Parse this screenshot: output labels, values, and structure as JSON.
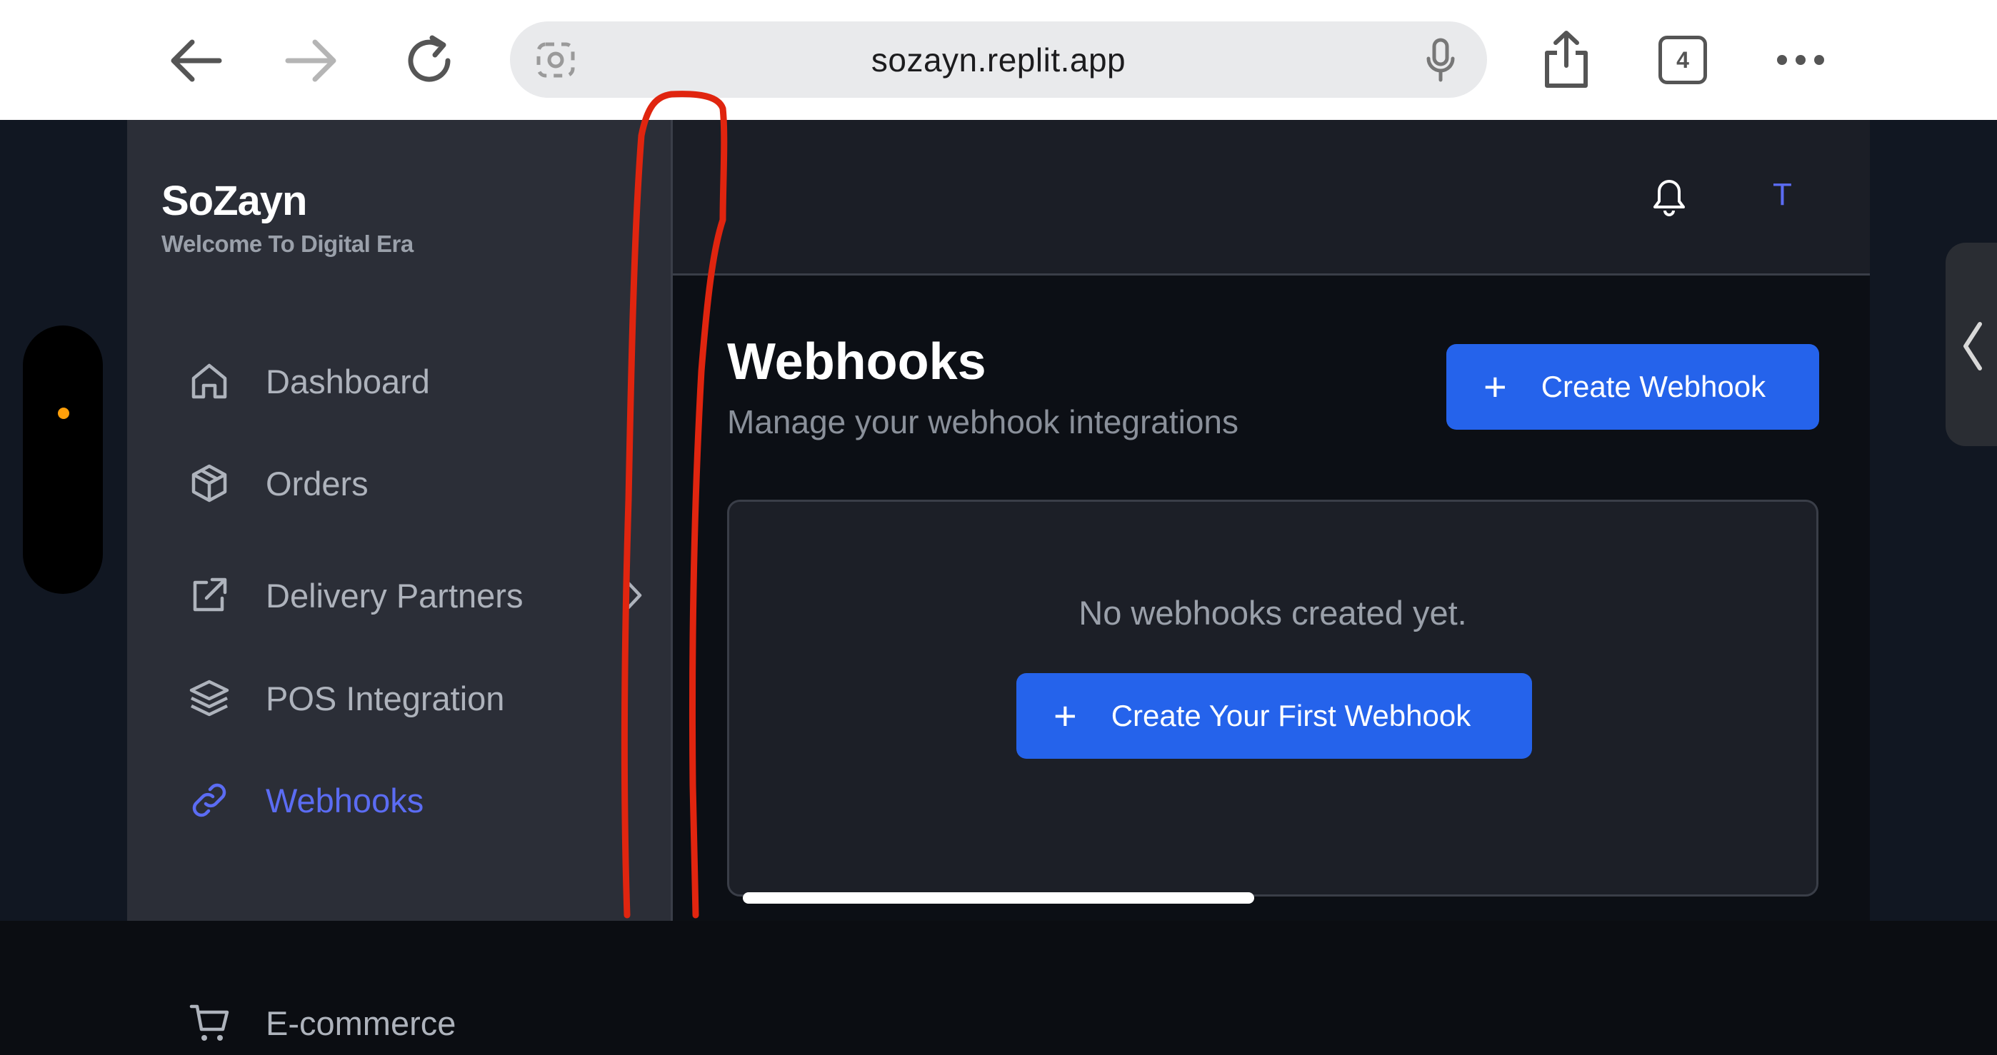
{
  "browser": {
    "url": "sozayn.replit.app",
    "tab_count": "4",
    "icons": [
      "back-arrow-icon",
      "forward-arrow-icon",
      "reload-icon",
      "camera-icon",
      "microphone-icon",
      "share-icon",
      "more-icon"
    ]
  },
  "sidebar": {
    "brand": "SoZayn",
    "tagline": "Welcome To Digital Era",
    "items": [
      {
        "label": "Dashboard",
        "icon": "home-icon"
      },
      {
        "label": "Orders",
        "icon": "package-icon"
      },
      {
        "label": "Delivery Partners",
        "icon": "external-link-icon"
      },
      {
        "label": "POS Integration",
        "icon": "layers-icon"
      },
      {
        "label": "Webhooks",
        "icon": "link-icon",
        "active": true
      },
      {
        "label": "E-commerce",
        "icon": "cart-icon"
      }
    ]
  },
  "topbar": {
    "avatar_initial": "T"
  },
  "main": {
    "title": "Webhooks",
    "subtitle": "Manage your webhook integrations",
    "create_label": "Create Webhook",
    "empty_text": "No webhooks created yet.",
    "create_first_label": "Create Your First Webhook"
  },
  "colors": {
    "accent": "#2563eb",
    "active_nav": "#5b6cf3",
    "annotation": "#e0250f"
  }
}
